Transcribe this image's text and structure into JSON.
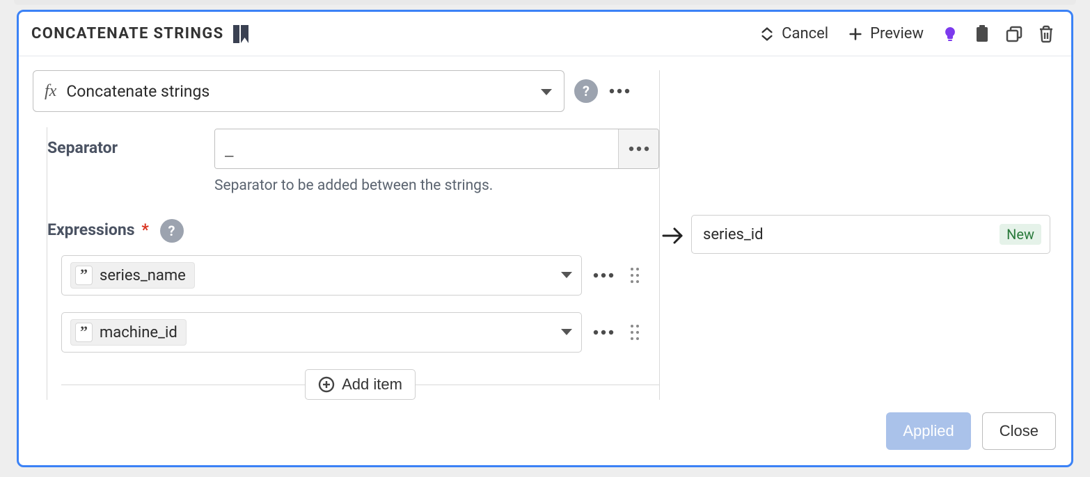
{
  "header": {
    "title": "CONCATENATE STRINGS",
    "cancel_label": "Cancel",
    "preview_label": "Preview"
  },
  "function": {
    "selected_label": "Concatenate strings"
  },
  "separator": {
    "label": "Separator",
    "value": "_",
    "help": "Separator to be added between the strings."
  },
  "expressions": {
    "label": "Expressions",
    "items": [
      {
        "type_icon": "”",
        "name": "series_name"
      },
      {
        "type_icon": "”",
        "name": "machine_id"
      }
    ],
    "add_label": "Add item"
  },
  "output": {
    "name": "series_id",
    "badge": "New"
  },
  "footer": {
    "applied_label": "Applied",
    "close_label": "Close"
  }
}
